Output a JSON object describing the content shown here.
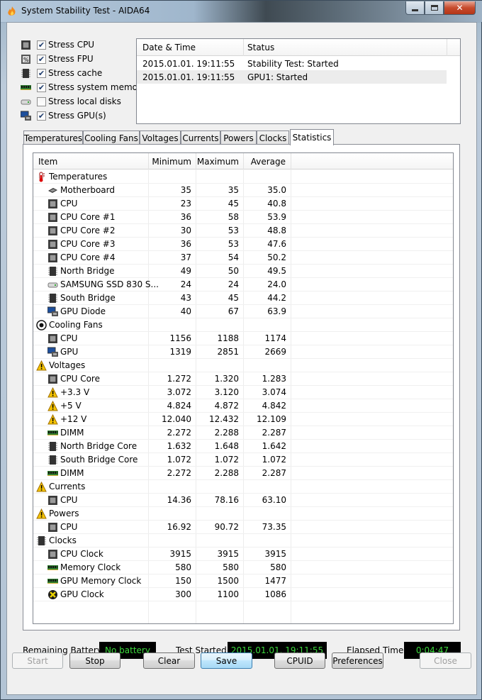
{
  "window": {
    "title": "System Stability Test - AIDA64"
  },
  "stress": [
    {
      "label": "Stress CPU",
      "checked": true,
      "icon": "cpu-icon"
    },
    {
      "label": "Stress FPU",
      "checked": true,
      "icon": "fpu-icon"
    },
    {
      "label": "Stress cache",
      "checked": true,
      "icon": "cache-chip-icon"
    },
    {
      "label": "Stress system memory",
      "checked": true,
      "icon": "memory-module-icon"
    },
    {
      "label": "Stress local disks",
      "checked": false,
      "icon": "disk-icon"
    },
    {
      "label": "Stress GPU(s)",
      "checked": true,
      "icon": "gpu-monitor-icon"
    }
  ],
  "log": {
    "headers": [
      "Date & Time",
      "Status"
    ],
    "rows": [
      [
        "2015.01.01. 19:11:55",
        "Stability Test: Started"
      ],
      [
        "2015.01.01. 19:11:55",
        "GPU1: Started"
      ]
    ]
  },
  "tabs": [
    "Temperatures",
    "Cooling Fans",
    "Voltages",
    "Currents",
    "Powers",
    "Clocks",
    "Statistics"
  ],
  "active_tab": "Statistics",
  "stats": {
    "headers": [
      "Item",
      "Minimum",
      "Maximum",
      "Average"
    ],
    "rows": [
      {
        "type": "group",
        "name": "Temperatures",
        "icon": "thermometer-icon"
      },
      {
        "name": "Motherboard",
        "icon": "motherboard-icon",
        "min": "35",
        "max": "35",
        "avg": "35.0"
      },
      {
        "name": "CPU",
        "icon": "cpu-icon",
        "min": "23",
        "max": "45",
        "avg": "40.8"
      },
      {
        "name": "CPU Core #1",
        "icon": "cpu-icon",
        "min": "36",
        "max": "58",
        "avg": "53.9"
      },
      {
        "name": "CPU Core #2",
        "icon": "cpu-icon",
        "min": "30",
        "max": "53",
        "avg": "48.8"
      },
      {
        "name": "CPU Core #3",
        "icon": "cpu-icon",
        "min": "36",
        "max": "53",
        "avg": "47.6"
      },
      {
        "name": "CPU Core #4",
        "icon": "cpu-icon",
        "min": "37",
        "max": "54",
        "avg": "50.2"
      },
      {
        "name": "North Bridge",
        "icon": "chip-icon",
        "min": "49",
        "max": "50",
        "avg": "49.5"
      },
      {
        "name": "SAMSUNG SSD 830 S...",
        "icon": "disk-icon",
        "min": "24",
        "max": "24",
        "avg": "24.0"
      },
      {
        "name": "South Bridge",
        "icon": "chip-icon",
        "min": "43",
        "max": "45",
        "avg": "44.2"
      },
      {
        "name": "GPU Diode",
        "icon": "gpu-monitor-icon",
        "min": "40",
        "max": "67",
        "avg": "63.9"
      },
      {
        "type": "group",
        "name": "Cooling Fans",
        "icon": "fan-icon"
      },
      {
        "name": "CPU",
        "icon": "cpu-icon",
        "min": "1156",
        "max": "1188",
        "avg": "1174"
      },
      {
        "name": "GPU",
        "icon": "gpu-monitor-icon",
        "min": "1319",
        "max": "2851",
        "avg": "2669"
      },
      {
        "type": "group",
        "name": "Voltages",
        "icon": "warning-icon"
      },
      {
        "name": "CPU Core",
        "icon": "cpu-icon",
        "min": "1.272",
        "max": "1.320",
        "avg": "1.283"
      },
      {
        "name": "+3.3 V",
        "icon": "warning-icon",
        "min": "3.072",
        "max": "3.120",
        "avg": "3.074"
      },
      {
        "name": "+5 V",
        "icon": "warning-icon",
        "min": "4.824",
        "max": "4.872",
        "avg": "4.842"
      },
      {
        "name": "+12 V",
        "icon": "warning-icon",
        "min": "12.040",
        "max": "12.432",
        "avg": "12.109"
      },
      {
        "name": "DIMM",
        "icon": "memory-module-icon",
        "min": "2.272",
        "max": "2.288",
        "avg": "2.287"
      },
      {
        "name": "North Bridge Core",
        "icon": "chip-icon",
        "min": "1.632",
        "max": "1.648",
        "avg": "1.642"
      },
      {
        "name": "South Bridge Core",
        "icon": "chip-icon",
        "min": "1.072",
        "max": "1.072",
        "avg": "1.072"
      },
      {
        "name": "DIMM",
        "icon": "memory-module-icon",
        "min": "2.272",
        "max": "2.288",
        "avg": "2.287"
      },
      {
        "type": "group",
        "name": "Currents",
        "icon": "warning-icon"
      },
      {
        "name": "CPU",
        "icon": "cpu-icon",
        "min": "14.36",
        "max": "78.16",
        "avg": "63.10"
      },
      {
        "type": "group",
        "name": "Powers",
        "icon": "warning-icon"
      },
      {
        "name": "CPU",
        "icon": "cpu-icon",
        "min": "16.92",
        "max": "90.72",
        "avg": "73.35"
      },
      {
        "type": "group",
        "name": "Clocks",
        "icon": "chip-icon"
      },
      {
        "name": "CPU Clock",
        "icon": "cpu-icon",
        "min": "3915",
        "max": "3915",
        "avg": "3915"
      },
      {
        "name": "Memory Clock",
        "icon": "memory-module-icon",
        "min": "580",
        "max": "580",
        "avg": "580"
      },
      {
        "name": "GPU Memory Clock",
        "icon": "memory-module-icon",
        "min": "150",
        "max": "1500",
        "avg": "1477"
      },
      {
        "name": "GPU Clock",
        "icon": "xbox-icon",
        "min": "300",
        "max": "1100",
        "avg": "1086"
      }
    ]
  },
  "status": {
    "battery_label": "Remaining Battery:",
    "battery_value": "No battery",
    "started_label": "Test Started:",
    "started_value": "2015.01.01. 19:11:55",
    "elapsed_label": "Elapsed Time:",
    "elapsed_value": "0:04:47"
  },
  "buttons": {
    "start": "Start",
    "stop": "Stop",
    "clear": "Clear",
    "save": "Save",
    "cpuid": "CPUID",
    "preferences": "Preferences",
    "close": "Close"
  },
  "colors": {
    "status_text": "#3cd83c",
    "status_bg": "#000000",
    "accent": "#3c7fb1"
  }
}
